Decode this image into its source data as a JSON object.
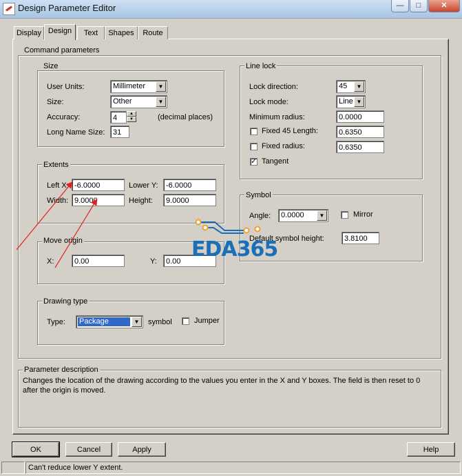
{
  "window": {
    "title": "Design Parameter Editor"
  },
  "tabs": [
    "Display",
    "Design",
    "Text",
    "Shapes",
    "Route"
  ],
  "command_parameters": {
    "legend": "Command parameters",
    "size": {
      "legend": "Size",
      "user_units_label": "User Units:",
      "user_units_value": "Millimeter",
      "size_label": "Size:",
      "size_value": "Other",
      "accuracy_label": "Accuracy:",
      "accuracy_value": "4",
      "accuracy_suffix": "(decimal places)",
      "long_name_label": "Long Name Size:",
      "long_name_value": "31"
    },
    "extents": {
      "legend": "Extents",
      "left_x_label": "Left X:",
      "left_x_value": "-6.0000",
      "lower_y_label": "Lower Y:",
      "lower_y_value": "-6.0000",
      "width_label": "Width:",
      "width_value": "9.0000",
      "height_label": "Height:",
      "height_value": "9.0000"
    },
    "move_origin": {
      "legend": "Move origin",
      "x_label": "X:",
      "x_value": "0.00",
      "y_label": "Y:",
      "y_value": "0.00"
    },
    "drawing_type": {
      "legend": "Drawing type",
      "type_label": "Type:",
      "type_value": "Package",
      "symbol_label": "symbol",
      "jumper_label": "Jumper",
      "jumper_checked": false
    },
    "line_lock": {
      "legend": "Line lock",
      "lock_direction_label": "Lock direction:",
      "lock_direction_value": "45",
      "lock_mode_label": "Lock mode:",
      "lock_mode_value": "Line",
      "min_radius_label": "Minimum radius:",
      "min_radius_value": "0.0000",
      "fixed45_label": "Fixed 45 Length:",
      "fixed45_value": "0.6350",
      "fixed45_checked": false,
      "fixed_radius_label": "Fixed radius:",
      "fixed_radius_value": "0.6350",
      "fixed_radius_checked": false,
      "tangent_label": "Tangent",
      "tangent_checked": true
    },
    "symbol": {
      "legend": "Symbol",
      "angle_label": "Angle:",
      "angle_value": "0.0000",
      "mirror_label": "Mirror",
      "mirror_checked": false,
      "default_height_label": "Default symbol height:",
      "default_height_value": "3.8100"
    }
  },
  "parameter_description": {
    "legend": "Parameter description",
    "line1": "Changes the location of the drawing according to the values you enter in the X and Y boxes. The field is then reset to 0",
    "line2": "after the origin is moved."
  },
  "buttons": {
    "ok": "OK",
    "cancel": "Cancel",
    "apply": "Apply",
    "help": "Help"
  },
  "status": {
    "message": "Can't reduce lower Y extent."
  },
  "watermark": {
    "text": "EDA365"
  },
  "icons": {
    "app": "app-icon",
    "minimize": "minimize-icon",
    "maximize": "maximize-icon",
    "close": "close-icon",
    "dropdown": "chevron-down-icon",
    "checkmark": "checkmark-icon"
  },
  "colors": {
    "selection": "#3169c6",
    "annotation_arrow": "#e02020",
    "watermark_blue": "#1a6fb8",
    "watermark_orange": "#f0a030"
  }
}
